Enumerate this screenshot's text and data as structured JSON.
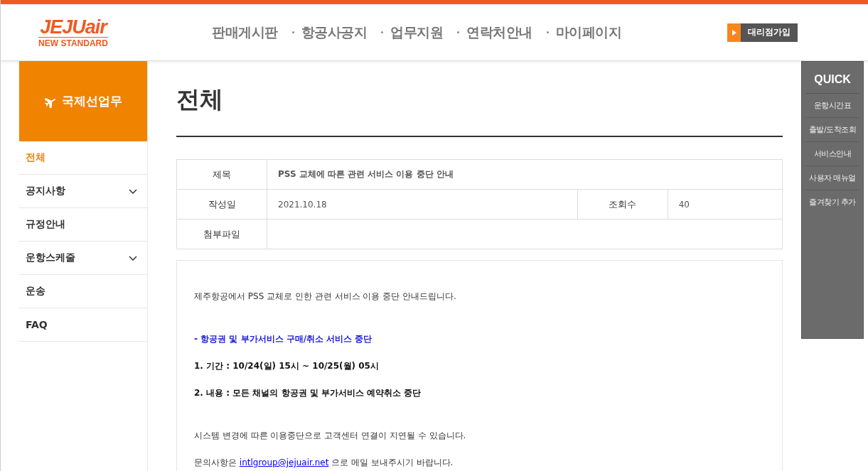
{
  "logo": {
    "brand": "JEJUair",
    "tagline": "NEW STANDARD"
  },
  "nav": [
    "판매게시판",
    "항공사공지",
    "업무지원",
    "연락처안내",
    "마이페이지"
  ],
  "join_button": "대리점가입",
  "sidebar": {
    "title": "국제선업무",
    "items": [
      {
        "label": "전체",
        "selected": true,
        "expandable": false
      },
      {
        "label": "공지사항",
        "selected": false,
        "expandable": true
      },
      {
        "label": "규정안내",
        "selected": false,
        "expandable": false
      },
      {
        "label": "운항스케줄",
        "selected": false,
        "expandable": true
      },
      {
        "label": "운송",
        "selected": false,
        "expandable": false
      },
      {
        "label": "FAQ",
        "selected": false,
        "expandable": false
      }
    ]
  },
  "page_title": "전체",
  "info": {
    "title_label": "제목",
    "title": "PSS 교체에 따른 관련 서비스 이용 중단 안내",
    "date_label": "작성일",
    "date": "2021.10.18",
    "views_label": "조회수",
    "views": "40",
    "attachment_label": "첨부파일"
  },
  "body": [
    [
      {
        "kind": "plain",
        "text": "제주항공에서 PSS 교체로 인한 관련 서비스 이용 중단 안내드립니다."
      }
    ],
    [
      {
        "kind": "highlight",
        "text": "- 항공권 및 부가서비스 구매/취소 서비스 중단"
      },
      {
        "kind": "bold",
        "text": "1. 기간 : 10/24(일) 15시 ~ 10/25(월) 05시"
      },
      {
        "kind": "bold",
        "text": "2. 내용 : 모든 채널의 항공권 및 부가서비스 예약취소 중단"
      }
    ],
    [
      {
        "kind": "plain",
        "text": "시스템 변경에 따른 이용중단으로 고객센터 연결이 지연될 수 있습니다."
      },
      {
        "kind": "link",
        "before": "문의사항은 ",
        "link": "intlgroup@jejuair.net",
        "after": " 으로 메일 보내주시기 바랍니다."
      }
    ]
  ],
  "quick": {
    "title": "QUICK",
    "items": [
      "운항시간표",
      "출발/도착조회",
      "서비스안내",
      "사용자 매뉴얼",
      "즐겨찾기 추가"
    ]
  }
}
